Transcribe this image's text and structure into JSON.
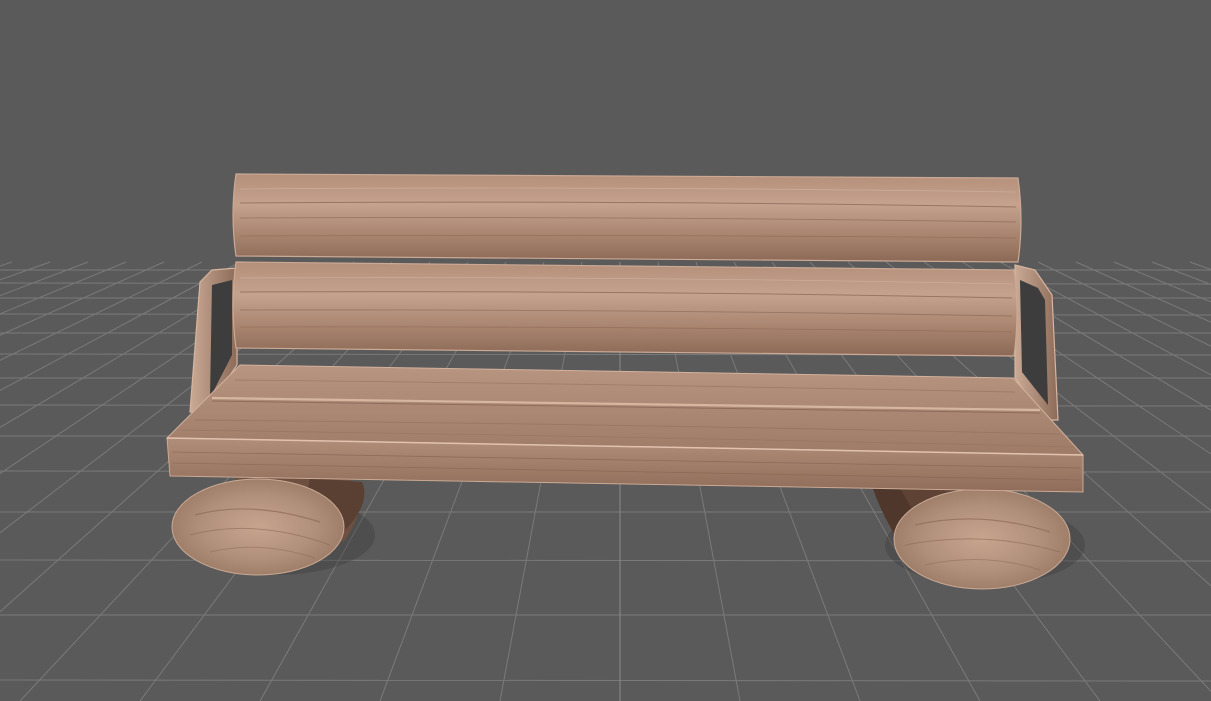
{
  "viewport": {
    "background_color": "#5a5a5a",
    "grid_line_color": "#7a7a7a",
    "grid_major_line_color": "#8a8a8a"
  },
  "scene": {
    "object": "bench-3d-model",
    "material": "light-oak-wood",
    "wood_base_color": "#a88672",
    "wood_light_color": "#c7a590",
    "wood_dark_color": "#7c5a48",
    "frame_edge_color": "#d7b6a0",
    "shadow_color": "#2f2f2f"
  }
}
